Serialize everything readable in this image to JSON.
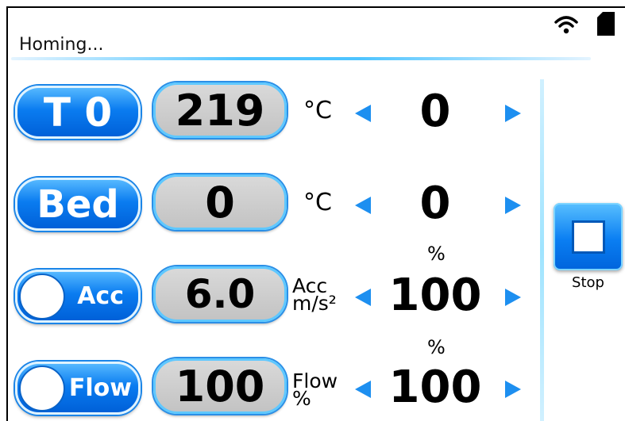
{
  "status_text": "Homing...",
  "rows": [
    {
      "button_label": "T 0",
      "current": "219",
      "unit": "°C",
      "target": "0"
    },
    {
      "button_label": "Bed",
      "current": "0",
      "unit": "°C",
      "target": "0"
    },
    {
      "button_label": "Acc",
      "current": "6.0",
      "unit_line1": "Acc",
      "unit_line2": "m/s²",
      "percent_label": "%",
      "target": "100"
    },
    {
      "button_label": "Flow",
      "current": "100",
      "unit_line1": "Flow",
      "unit_line2": "%",
      "percent_label": "%",
      "target": "100"
    }
  ],
  "stop_label": "Stop",
  "colors": {
    "accent": "#0a7cf0",
    "arrow": "#1d8ff0",
    "field": "#c8c8c8"
  }
}
